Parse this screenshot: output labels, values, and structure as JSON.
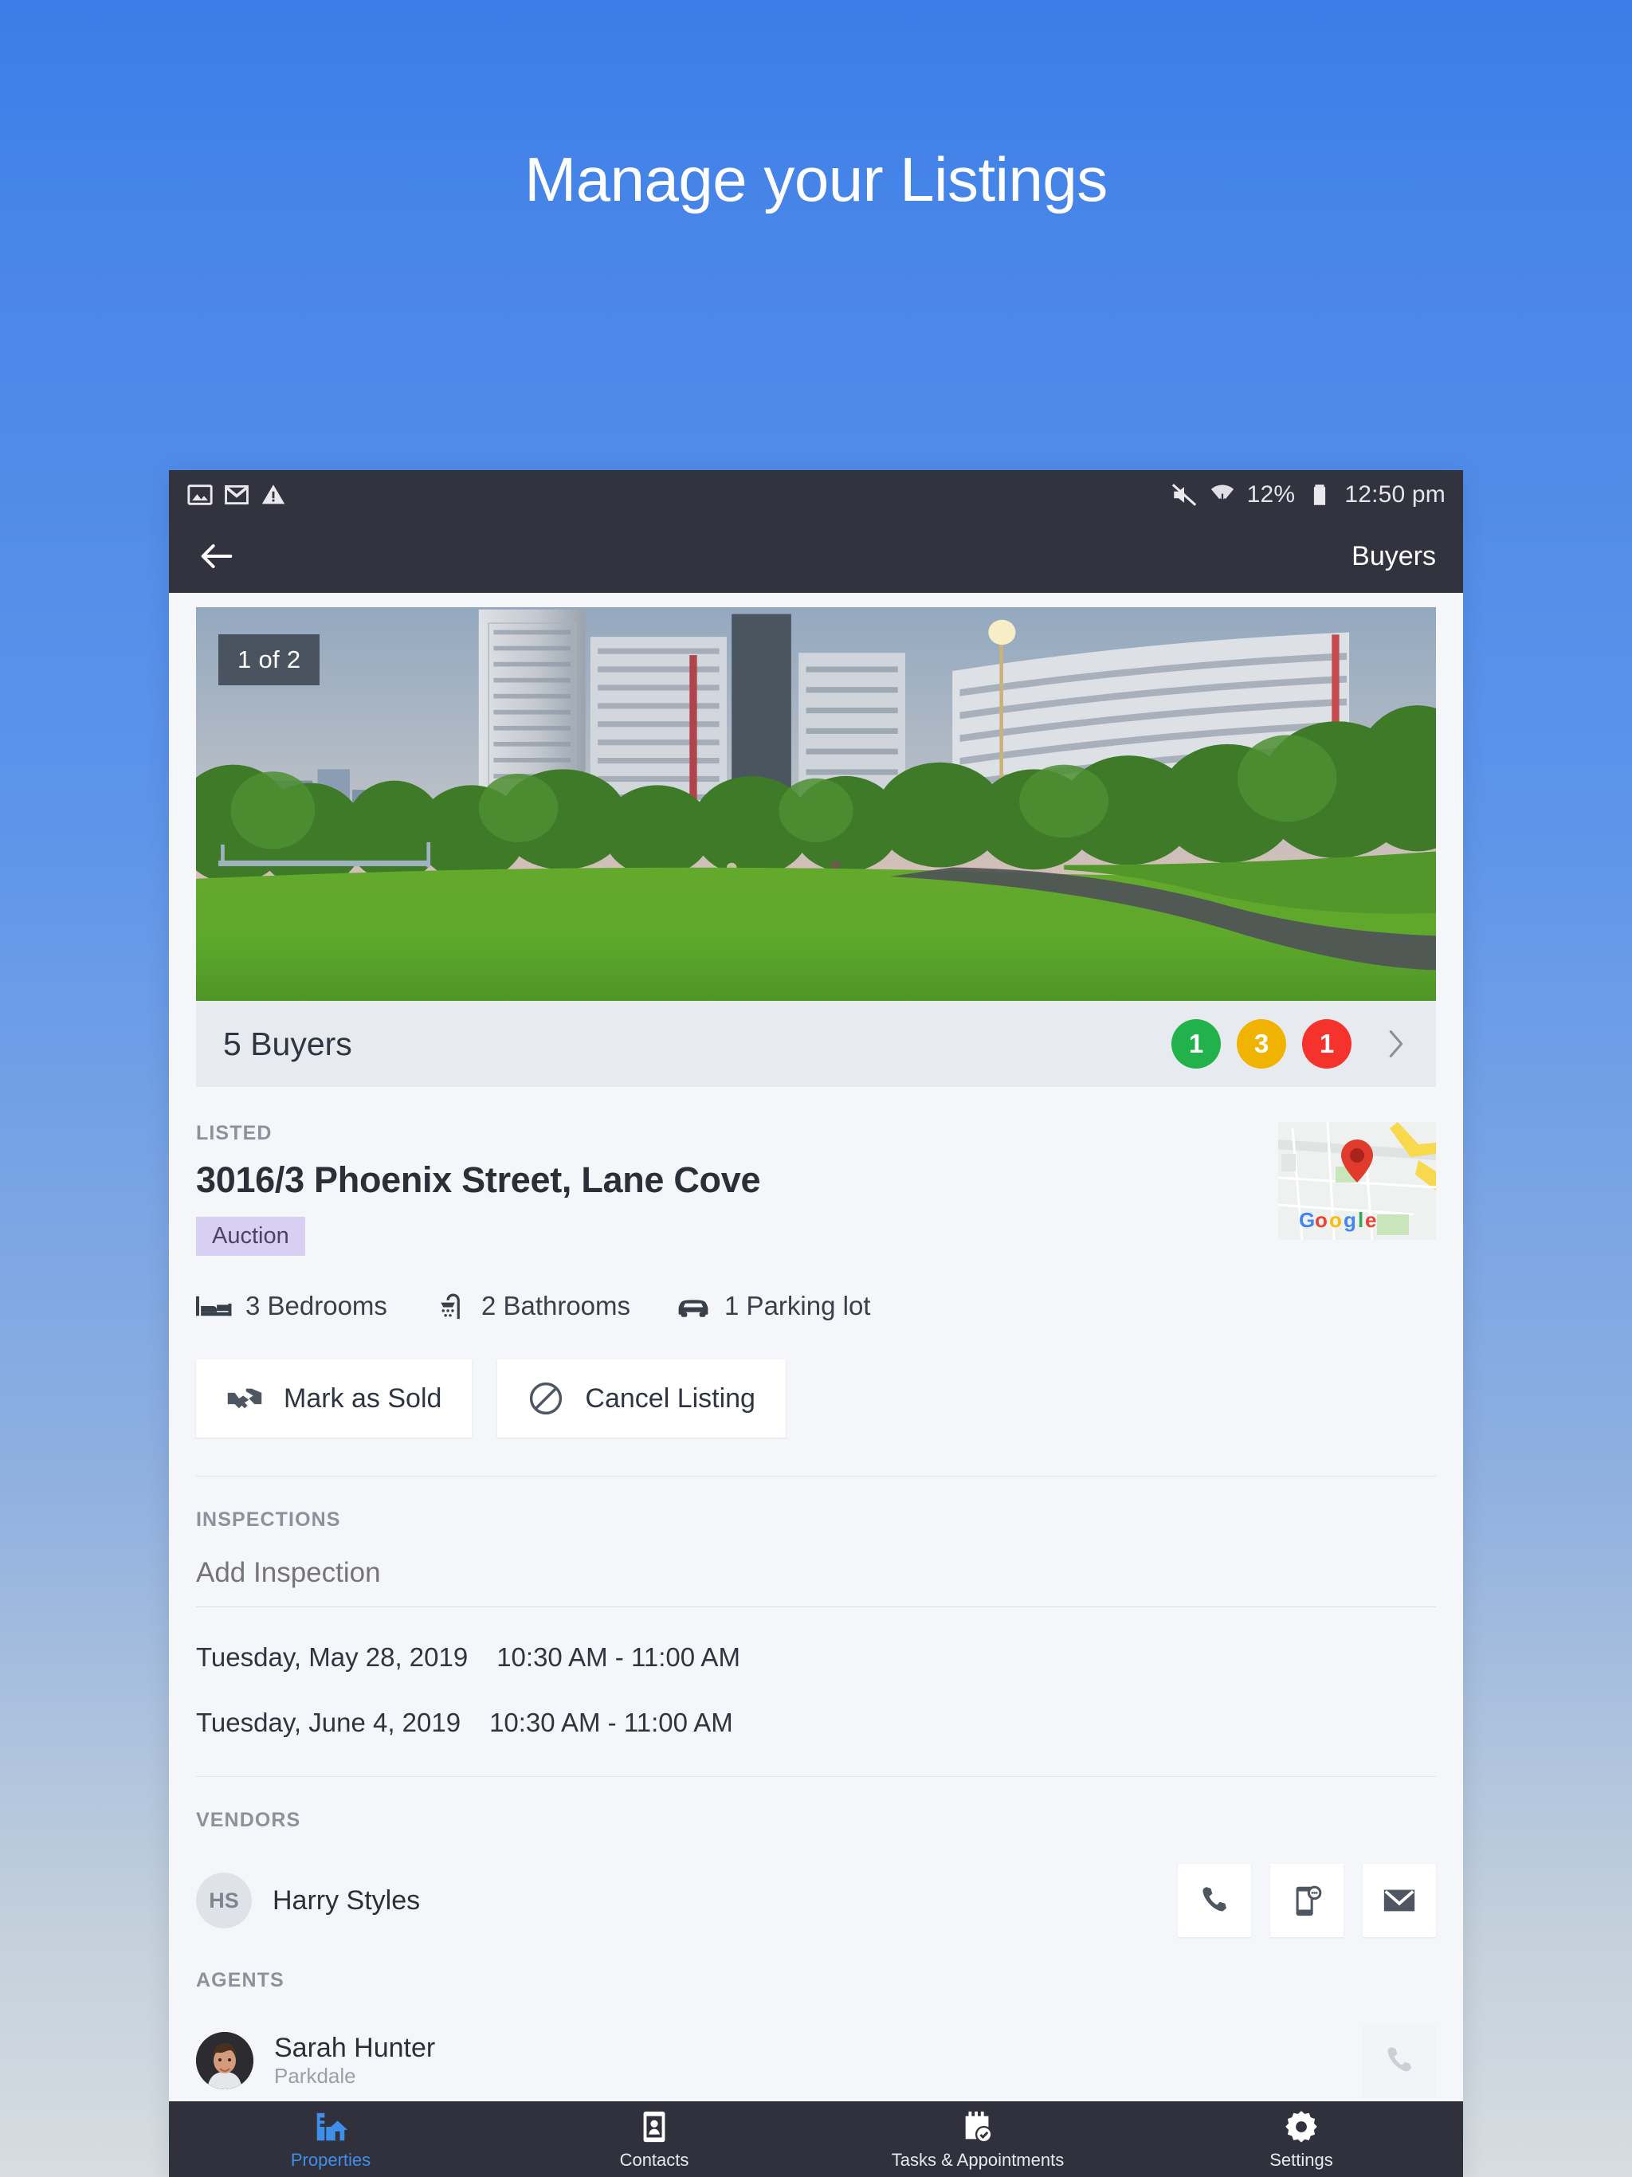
{
  "promo": {
    "headline": "Manage your Listings"
  },
  "status_bar": {
    "icons_left": [
      "image-icon",
      "mail-icon",
      "warning-icon"
    ],
    "icons_right": [
      "mute-icon",
      "wifi-icon",
      "battery-icon"
    ],
    "battery_text": "12%",
    "time": "12:50 pm"
  },
  "app_bar": {
    "back_icon": "back-arrow-icon",
    "title": "Buyers"
  },
  "hero": {
    "photo_counter": "1 of 2",
    "alt": "park lawn with apartment towers"
  },
  "buyers_bar": {
    "label": "5 Buyers",
    "badges": [
      {
        "count": "1",
        "color": "#22b24c"
      },
      {
        "count": "3",
        "color": "#f0b400"
      },
      {
        "count": "1",
        "color": "#f5322b"
      }
    ],
    "chevron": "chevron-right-icon"
  },
  "listing": {
    "status_label": "LISTED",
    "address": "3016/3 Phoenix Street, Lane Cove",
    "sale_method": "Auction",
    "sale_method_bg": "#d7d0f2",
    "sale_method_fg": "#4d4263",
    "map_brand": "Google",
    "features": [
      {
        "icon": "bed-icon",
        "text": "3 Bedrooms"
      },
      {
        "icon": "shower-icon",
        "text": "2 Bathrooms"
      },
      {
        "icon": "car-icon",
        "text": "1 Parking lot"
      }
    ],
    "actions": [
      {
        "icon": "handshake-icon",
        "label": "Mark as Sold"
      },
      {
        "icon": "block-icon",
        "label": "Cancel Listing"
      }
    ]
  },
  "inspections": {
    "label": "INSPECTIONS",
    "add_placeholder": "Add Inspection",
    "items": [
      {
        "date": "Tuesday, May 28, 2019",
        "time": "10:30 AM - 11:00 AM"
      },
      {
        "date": "Tuesday, June 4, 2019",
        "time": "10:30 AM - 11:00 AM"
      }
    ]
  },
  "vendors": {
    "label": "VENDORS",
    "person": {
      "initials": "HS",
      "name": "Harry Styles"
    },
    "actions": [
      "phone-icon",
      "sms-icon",
      "email-icon"
    ]
  },
  "agents": {
    "label": "AGENTS",
    "person": {
      "name": "Sarah Hunter",
      "office": "Parkdale"
    },
    "actions": [
      "phone-icon"
    ]
  },
  "bottom_nav": {
    "active_color": "#3f8fe8",
    "items": [
      {
        "icon": "properties-icon",
        "label": "Properties",
        "active": true
      },
      {
        "icon": "contacts-icon",
        "label": "Contacts",
        "active": false
      },
      {
        "icon": "tasks-icon",
        "label": "Tasks & Appointments",
        "active": false
      },
      {
        "icon": "settings-icon",
        "label": "Settings",
        "active": false
      }
    ]
  }
}
